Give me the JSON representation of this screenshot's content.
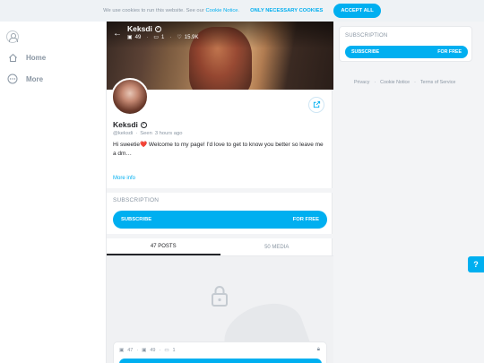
{
  "cookie": {
    "message": "We use cookies to run this website. See our",
    "link": "Cookie Notice",
    "link_suffix": ".",
    "necessary_label": "ONLY NECESSARY COOKIES",
    "accept_label": "ACCEPT ALL"
  },
  "nav": {
    "items": [
      {
        "label": "Home",
        "icon": "home-icon"
      },
      {
        "label": "More",
        "icon": "more-icon"
      }
    ]
  },
  "profile": {
    "name": "Keksdi",
    "handle": "@keksdi",
    "seen": "Seen",
    "last_seen": "3 hours ago",
    "stats": {
      "photos": "49",
      "videos": "1",
      "likes": "15.9K"
    },
    "bio": "Hi sweetie❤️ Welcome to my page! I'd love to get to know you better so leave me a dm…",
    "more_info": "More info"
  },
  "subscription": {
    "title": "SUBSCRIPTION",
    "button_label": "SUBSCRIBE",
    "price": "FOR FREE"
  },
  "tabs": [
    {
      "label": "47 POSTS",
      "active": true
    },
    {
      "label": "50 MEDIA",
      "active": false
    }
  ],
  "locked_post": {
    "posts": "47",
    "photos": "49",
    "videos": "1"
  },
  "footer": {
    "links": [
      "Privacy",
      "·",
      "Cookie Notice",
      "·",
      "Terms of Service"
    ]
  },
  "colors": {
    "accent": "#00aff0",
    "text": "#242529",
    "muted": "#8a96a3"
  }
}
